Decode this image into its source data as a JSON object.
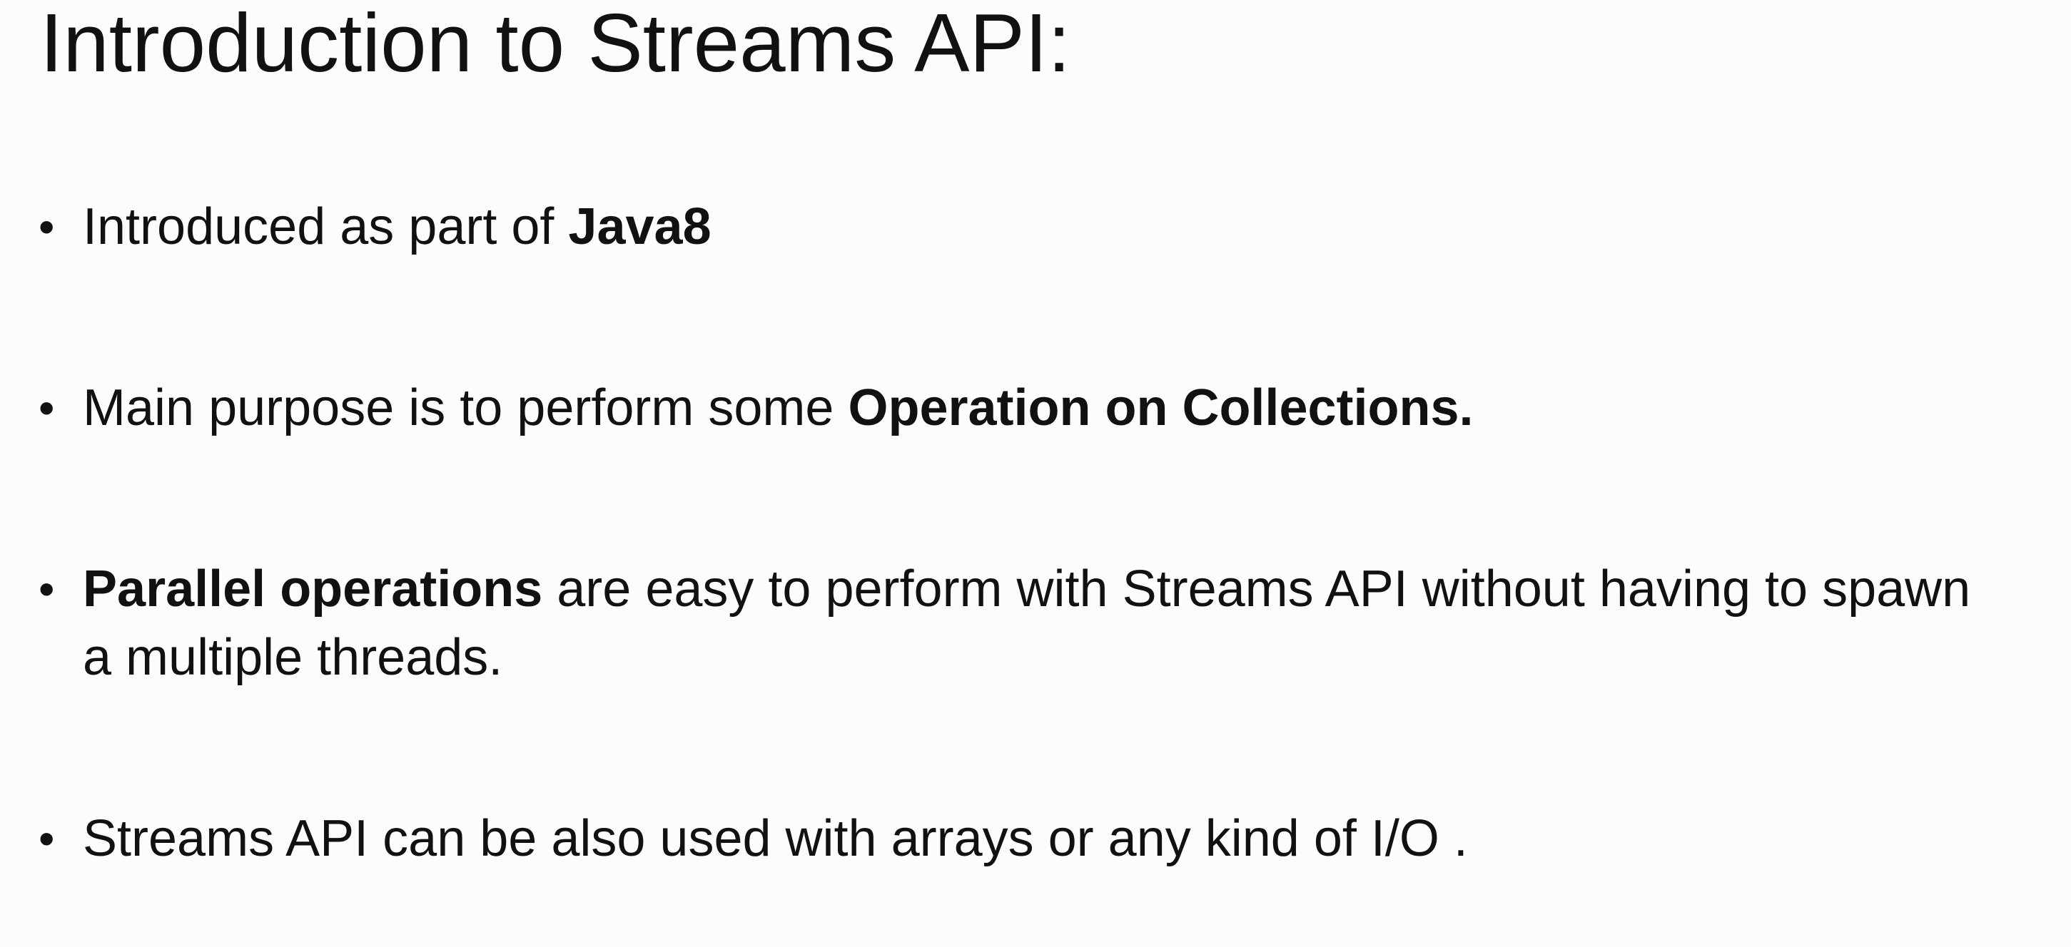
{
  "title": "Introduction to Streams API:",
  "bullets": [
    {
      "before": "Introduced as part of ",
      "bold": "Java8",
      "after": ""
    },
    {
      "before": "Main purpose is to perform some ",
      "bold": "Operation on Collections.",
      "after": ""
    },
    {
      "before": "",
      "bold": "Parallel operations",
      "after": " are easy to perform with Streams API without having to spawn a multiple threads."
    },
    {
      "before": "Streams API can be also used with arrays or any kind of I/O .",
      "bold": "",
      "after": ""
    }
  ],
  "bullet_symbol": "•"
}
